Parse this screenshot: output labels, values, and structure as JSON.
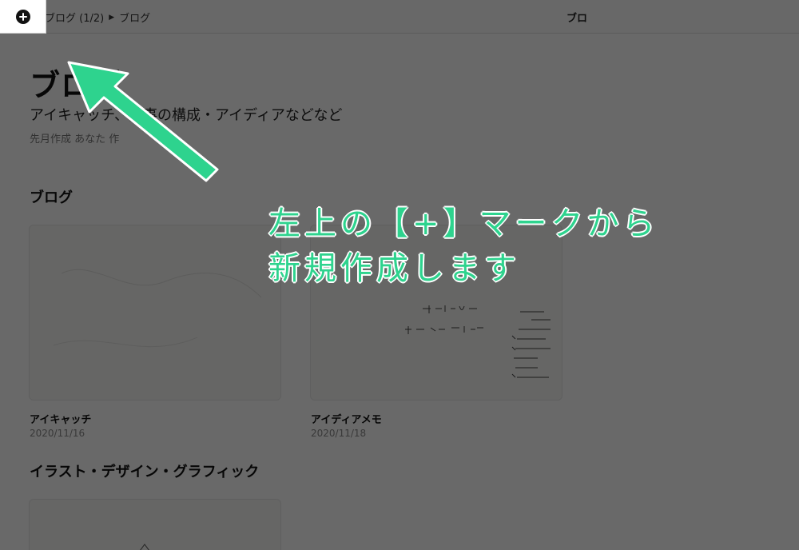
{
  "breadcrumb": {
    "items": [
      "ブログ (1/2)",
      "ブログ"
    ]
  },
  "topbar": {
    "title": "ブロ"
  },
  "page": {
    "title": "ブログ",
    "subtitle": "アイキャッチ、記事の構成・アイディアなどなど",
    "meta": "先月作成 あなた 作"
  },
  "sections": [
    {
      "heading": "ブログ",
      "cards": [
        {
          "title": "アイキャッチ",
          "date": "2020/11/16"
        },
        {
          "title": "アイディアメモ",
          "date": "2020/11/18"
        }
      ]
    },
    {
      "heading": "イラスト・デザイン・グラフィック",
      "cards": []
    }
  ],
  "annotation": {
    "line1": "左上の【+】マークから",
    "line2": "新規作成します",
    "color": "#2ed38e"
  },
  "icons": {
    "add": "plus-circle-icon",
    "breadcrumb_separator": "triangle-right-icon"
  }
}
